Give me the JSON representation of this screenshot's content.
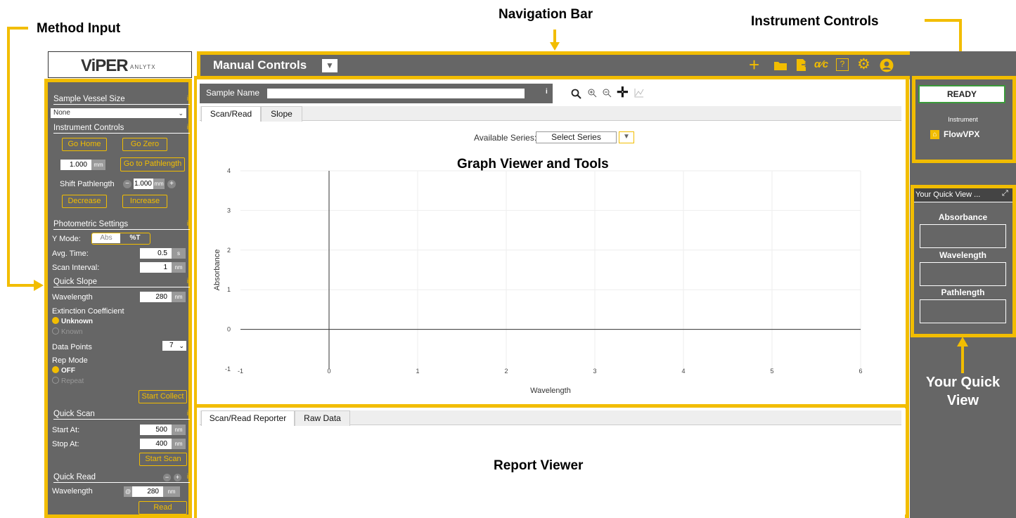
{
  "callouts": {
    "method_input": "Method Input",
    "navigation_bar": "Navigation Bar",
    "instrument_controls": "Instrument Controls",
    "graph_viewer": "Graph Viewer and Tools",
    "report_viewer": "Report Viewer",
    "your_quick_view_1": "Your Quick",
    "your_quick_view_2": "View"
  },
  "logo": {
    "main": "ViPER",
    "sub": "ANLYTX"
  },
  "nav": {
    "title": "Manual Controls"
  },
  "left": {
    "sample_vessel": {
      "title": "Sample Vessel Size",
      "info": "i",
      "value": "None"
    },
    "instrument": {
      "title": "Instrument Controls",
      "info": "i",
      "go_home": "Go Home",
      "go_zero": "Go Zero",
      "pathlength": "1.000",
      "unit_mm": "mm",
      "go_path": "Go to Pathlength",
      "shift_label": "Shift Pathlength",
      "shift_value": "1.000",
      "decrease": "Decrease",
      "increase": "Increase"
    },
    "photometric": {
      "title": "Photometric Settings",
      "info": "i",
      "ymode_label": "Y Mode:",
      "abs": "Abs",
      "pct": "%T",
      "avg_label": "Avg. Time:",
      "avg_value": "0.5",
      "avg_unit": "s",
      "interval_label": "Scan Interval:",
      "interval_value": "1",
      "interval_unit": "nm"
    },
    "quick_slope": {
      "title": "Quick Slope",
      "info": "i",
      "wl_label": "Wavelength",
      "wl_value": "280",
      "wl_unit": "nm",
      "ext_label": "Extinction Coefficient",
      "unknown": "Unknown",
      "known": "Known",
      "dp_label": "Data Points",
      "dp_value": "7",
      "rep_label": "Rep Mode",
      "off": "OFF",
      "repeat": "Repeat",
      "start": "Start Collect"
    },
    "quick_scan": {
      "title": "Quick Scan",
      "info": "i",
      "start_label": "Start At:",
      "start_value": "500",
      "stop_label": "Stop At:",
      "stop_value": "400",
      "unit": "nm",
      "button": "Start Scan"
    },
    "quick_read": {
      "title": "Quick Read",
      "info": "i",
      "wl_label": "Wavelength",
      "at": "@",
      "wl_value": "280",
      "unit": "nm",
      "button": "Read"
    }
  },
  "graph": {
    "sample_name_label": "Sample Name",
    "sample_name_value": "",
    "info": "i",
    "tabs": [
      "Scan/Read",
      "Slope"
    ],
    "series_label": "Available Series:",
    "series_value": "Select Series"
  },
  "report": {
    "tabs": [
      "Scan/Read Reporter",
      "Raw Data"
    ]
  },
  "right": {
    "ready": "READY",
    "instrument_label": "Instrument",
    "instrument_name": "FlowVPX",
    "quick_view_title": "Your Quick View ...",
    "qv_items": [
      "Absorbance",
      "Wavelength",
      "Pathlength"
    ]
  },
  "chart_data": {
    "type": "line",
    "title": "",
    "xlabel": "Wavelength",
    "ylabel": "Absorbance",
    "xlim": [
      -1,
      6
    ],
    "ylim": [
      -1,
      4
    ],
    "xticks": [
      "-1",
      "0",
      "1",
      "2",
      "3",
      "4",
      "5",
      "6"
    ],
    "yticks": [
      "-1",
      "0",
      "1",
      "2",
      "3",
      "4"
    ],
    "series": [],
    "grid": true
  },
  "colors": {
    "accent": "#f2bd00",
    "panel": "#666666",
    "ready_border": "#3a9a3a"
  }
}
